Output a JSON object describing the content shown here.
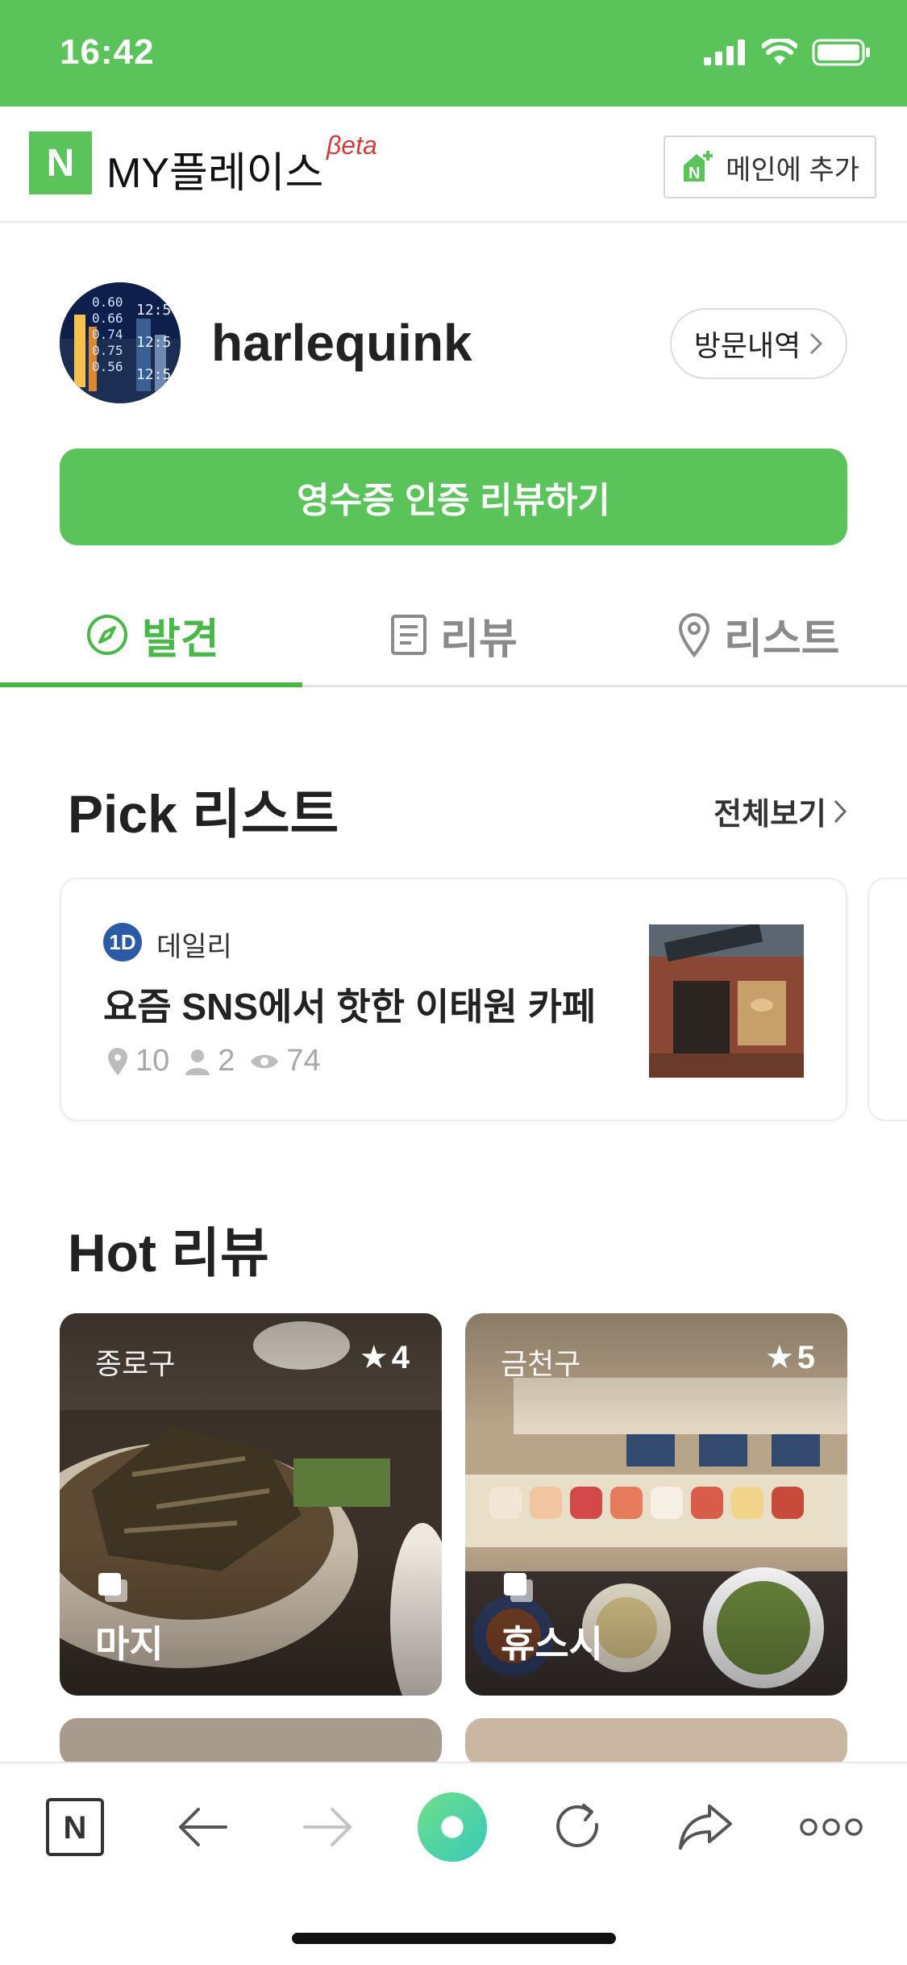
{
  "status_bar": {
    "time": "16:42"
  },
  "header": {
    "logo_letter": "N",
    "title": "MY플레이스",
    "beta": "βeta",
    "add_main_label": "메인에 추가"
  },
  "profile": {
    "username": "harlequink",
    "visit_history_label": "방문내역"
  },
  "receipt_review_button": "영수증 인증 리뷰하기",
  "tabs": [
    {
      "label": "발견",
      "icon": "compass-icon",
      "active": true
    },
    {
      "label": "리뷰",
      "icon": "document-icon",
      "active": false
    },
    {
      "label": "리스트",
      "icon": "location-pin-icon",
      "active": false
    }
  ],
  "pick_section": {
    "title": "Pick 리스트",
    "see_all": "전체보기",
    "card": {
      "badge": "1D",
      "author": "데일리",
      "title": "요즘 SNS에서 핫한 이태원 카페",
      "places": "10",
      "followers": "2",
      "views": "74"
    }
  },
  "hot_section": {
    "title": "Hot 리뷰",
    "reviews": [
      {
        "region": "종로구",
        "rating": "4",
        "name": "마지"
      },
      {
        "region": "금천구",
        "rating": "5",
        "name": "휴스시"
      }
    ]
  },
  "colors": {
    "brand_green": "#5ac359",
    "tab_active": "#48b848",
    "beta_red": "#d23b3b"
  },
  "browser_bar": [
    "naver-n-icon",
    "back-arrow-icon",
    "forward-arrow-icon",
    "green-dot-icon",
    "reload-icon",
    "share-icon",
    "more-icon"
  ]
}
